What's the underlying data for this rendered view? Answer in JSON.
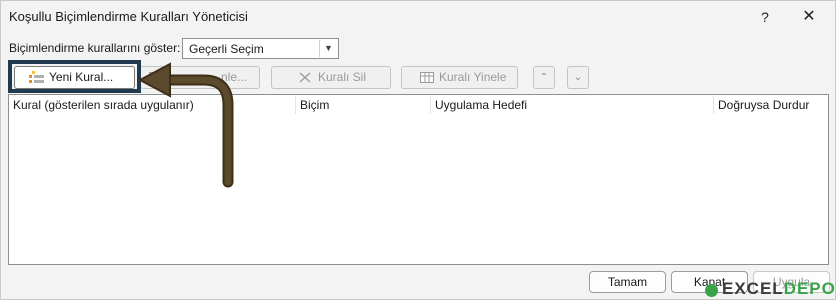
{
  "window": {
    "title": "Koşullu Biçimlendirme Kuralları Yöneticisi",
    "help_glyph": "?",
    "close_glyph": "✕"
  },
  "filter": {
    "label": "Biçimlendirme kurallarını göster:",
    "selected": "Geçerli Seçim"
  },
  "toolbar": {
    "new_rule": "Yeni Kural...",
    "edit_rule": "...nle...",
    "delete_rule": "Kuralı Sil",
    "duplicate_rule": "Kuralı Yinele",
    "move_up_glyph": "⌃",
    "move_down_glyph": "⌄"
  },
  "rules_table": {
    "columns": [
      "Kural (gösterilen sırada uygulanır)",
      "Biçim",
      "Uygulama Hedefi",
      "Doğruysa Durdur"
    ],
    "rows": []
  },
  "footer": {
    "ok": "Tamam",
    "cancel": "Kapat",
    "apply": "Uygula"
  },
  "watermark": {
    "text_a": "EXCEL",
    "text_b": "DEPO"
  },
  "colors": {
    "highlight_border": "#213a4f",
    "annotation_arrow": "#5b4a2c",
    "watermark_green": "#3aa34a"
  }
}
